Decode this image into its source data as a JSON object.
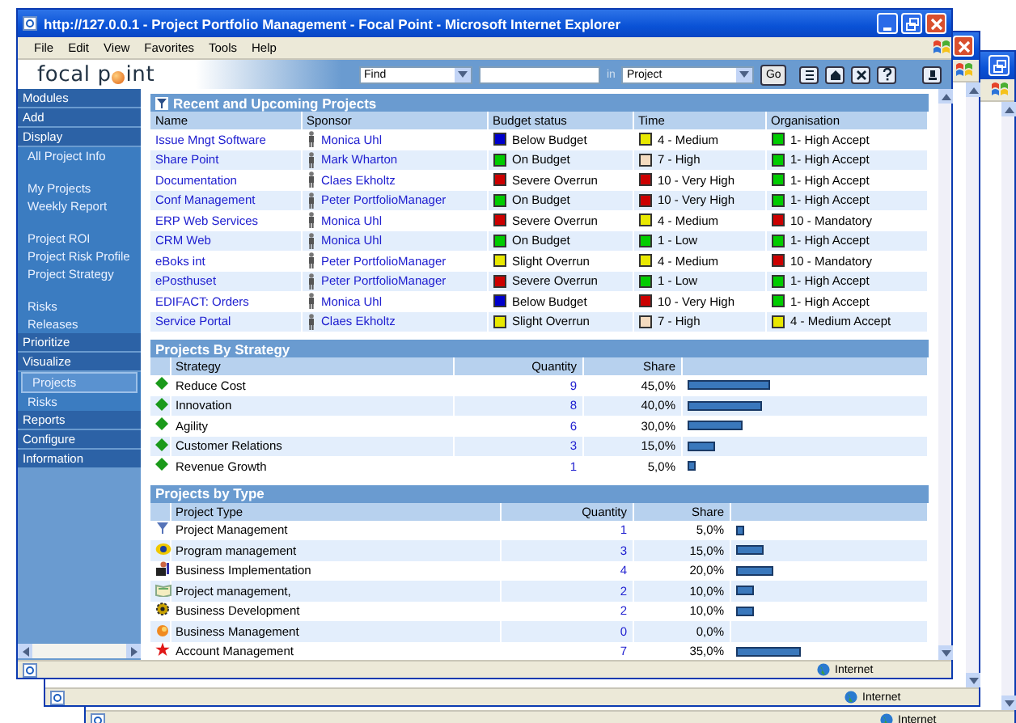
{
  "window": {
    "title": "http://127.0.0.1 - Project Portfolio Management - Focal Point - Microsoft Internet Explorer"
  },
  "menu": [
    "File",
    "Edit",
    "View",
    "Favorites",
    "Tools",
    "Help"
  ],
  "header": {
    "logo_before": "focal p",
    "logo_after": "int",
    "find": "Find",
    "in_label": "in",
    "scope": "Project",
    "go": "Go"
  },
  "sidebar": {
    "sections": [
      {
        "label": "Modules"
      },
      {
        "label": "Add"
      },
      {
        "label": "Display",
        "groups": [
          [
            {
              "label": "All Project Info",
              "selected": false
            }
          ],
          [
            {
              "label": "My Projects",
              "selected": false
            },
            {
              "label": "Weekly Report",
              "selected": false
            }
          ],
          [
            {
              "label": "Project ROI",
              "selected": false
            },
            {
              "label": "Project Risk Profile",
              "selected": false
            },
            {
              "label": "Project Strategy",
              "selected": false
            }
          ],
          [
            {
              "label": "Risks",
              "selected": false
            },
            {
              "label": "Releases",
              "selected": false
            }
          ]
        ]
      },
      {
        "label": "Prioritize"
      },
      {
        "label": "Visualize",
        "groups": [
          [
            {
              "label": "Projects",
              "selected": true
            },
            {
              "label": "Risks",
              "selected": false
            }
          ]
        ]
      },
      {
        "label": "Reports"
      },
      {
        "label": "Configure"
      },
      {
        "label": "Information"
      }
    ]
  },
  "recent": {
    "title": "Recent and Upcoming Projects",
    "columns": [
      "Name",
      "Sponsor",
      "Budget status",
      "Time",
      "Organisation"
    ],
    "rows": [
      {
        "name": "Issue Mngt Software",
        "sponsor": "Monica Uhl",
        "budget": {
          "text": "Below Budget",
          "color": "#0000cc"
        },
        "time": {
          "text": "4 - Medium",
          "color": "#e8e800"
        },
        "org": {
          "text": "1- High Accept",
          "color": "#00cc00"
        }
      },
      {
        "name": "Share Point",
        "sponsor": "Mark Wharton",
        "budget": {
          "text": "On Budget",
          "color": "#00cc00"
        },
        "time": {
          "text": "7 - High",
          "color": "#f5dcc0"
        },
        "org": {
          "text": "1- High Accept",
          "color": "#00cc00"
        }
      },
      {
        "name": "Documentation",
        "sponsor": "Claes Ekholtz",
        "budget": {
          "text": "Severe Overrun",
          "color": "#cc0000"
        },
        "time": {
          "text": "10 - Very High",
          "color": "#cc0000"
        },
        "org": {
          "text": "1- High Accept",
          "color": "#00cc00"
        }
      },
      {
        "name": "Conf Management",
        "sponsor": "Peter PortfolioManager",
        "budget": {
          "text": "On Budget",
          "color": "#00cc00"
        },
        "time": {
          "text": "10 - Very High",
          "color": "#cc0000"
        },
        "org": {
          "text": "1- High Accept",
          "color": "#00cc00"
        }
      },
      {
        "name": "ERP Web Services",
        "sponsor": "Monica Uhl",
        "budget": {
          "text": "Severe Overrun",
          "color": "#cc0000"
        },
        "time": {
          "text": "4 - Medium",
          "color": "#e8e800"
        },
        "org": {
          "text": "10 - Mandatory",
          "color": "#cc0000"
        }
      },
      {
        "name": "CRM Web",
        "sponsor": "Monica Uhl",
        "budget": {
          "text": "On Budget",
          "color": "#00cc00"
        },
        "time": {
          "text": "1 - Low",
          "color": "#00cc00"
        },
        "org": {
          "text": "1- High Accept",
          "color": "#00cc00"
        }
      },
      {
        "name": "eBoks int",
        "sponsor": "Peter PortfolioManager",
        "budget": {
          "text": "Slight Overrun",
          "color": "#e8e800"
        },
        "time": {
          "text": "4 - Medium",
          "color": "#e8e800"
        },
        "org": {
          "text": "10 - Mandatory",
          "color": "#cc0000"
        }
      },
      {
        "name": "ePosthuset",
        "sponsor": "Peter PortfolioManager",
        "budget": {
          "text": "Severe Overrun",
          "color": "#cc0000"
        },
        "time": {
          "text": "1 - Low",
          "color": "#00cc00"
        },
        "org": {
          "text": "1- High Accept",
          "color": "#00cc00"
        }
      },
      {
        "name": "EDIFACT: Orders",
        "sponsor": "Monica Uhl",
        "budget": {
          "text": "Below Budget",
          "color": "#0000cc"
        },
        "time": {
          "text": "10 - Very High",
          "color": "#cc0000"
        },
        "org": {
          "text": "1- High Accept",
          "color": "#00cc00"
        }
      },
      {
        "name": "Service Portal",
        "sponsor": "Claes Ekholtz",
        "budget": {
          "text": "Slight Overrun",
          "color": "#e8e800"
        },
        "time": {
          "text": "7 - High",
          "color": "#f5dcc0"
        },
        "org": {
          "text": "4 - Medium Accept",
          "color": "#e8e800"
        }
      }
    ]
  },
  "strategy": {
    "title": "Projects By Strategy",
    "columns": [
      "Strategy",
      "Quantity",
      "Share"
    ],
    "rows": [
      {
        "name": "Reduce Cost",
        "quantity": "9",
        "share": "45,0%"
      },
      {
        "name": "Innovation",
        "quantity": "8",
        "share": "40,0%"
      },
      {
        "name": "Agility",
        "quantity": "6",
        "share": "30,0%"
      },
      {
        "name": "Customer Relations",
        "quantity": "3",
        "share": "15,0%"
      },
      {
        "name": "Revenue Growth",
        "quantity": "1",
        "share": "5,0%"
      }
    ]
  },
  "types": {
    "title": "Projects by Type",
    "columns": [
      "Project Type",
      "Quantity",
      "Share"
    ],
    "rows": [
      {
        "name": "Project Management",
        "quantity": "1",
        "share": "5,0%"
      },
      {
        "name": "Program management",
        "quantity": "3",
        "share": "15,0%"
      },
      {
        "name": "Business Implementation",
        "quantity": "4",
        "share": "20,0%"
      },
      {
        "name": "Project management,",
        "quantity": "2",
        "share": "10,0%"
      },
      {
        "name": "Business Development",
        "quantity": "2",
        "share": "10,0%"
      },
      {
        "name": "Business Management",
        "quantity": "0",
        "share": "0,0%"
      },
      {
        "name": "Account Management",
        "quantity": "7",
        "share": "35,0%"
      }
    ]
  },
  "status_bar": {
    "zone": "Internet"
  },
  "background_windows": [
    {
      "zone": "Internet"
    },
    {
      "zone": "Internet"
    }
  ]
}
